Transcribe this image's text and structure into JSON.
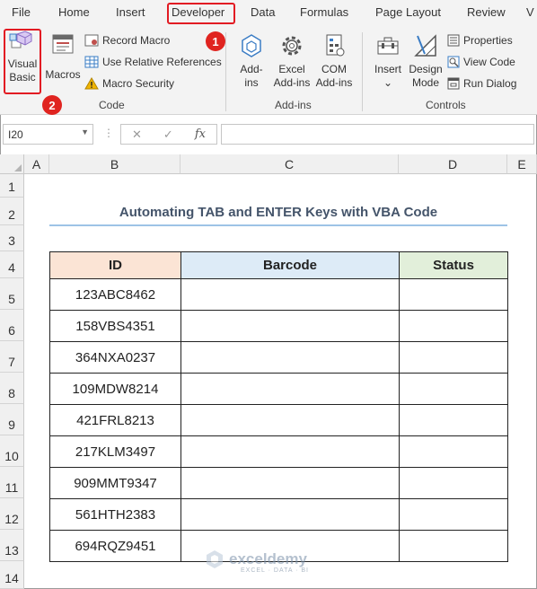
{
  "ribbon": {
    "tabs": [
      "File",
      "Home",
      "Insert",
      "Developer",
      "Data",
      "Formulas",
      "Page Layout",
      "Review",
      "V"
    ],
    "active_tab": "Developer",
    "code_group": {
      "label": "Code",
      "visual_basic": [
        "Visual",
        "Basic"
      ],
      "macros": "Macros",
      "record_macro": "Record Macro",
      "relative_refs": "Use Relative References",
      "macro_security": "Macro Security"
    },
    "addins_group": {
      "label": "Add-ins",
      "addins": [
        "Add-",
        "ins"
      ],
      "excel_addins": [
        "Excel",
        "Add-ins"
      ],
      "com_addins": [
        "COM",
        "Add-ins"
      ]
    },
    "controls_group": {
      "label": "Controls",
      "insert": "Insert",
      "design_mode": [
        "Design",
        "Mode"
      ],
      "properties": "Properties",
      "view_code": "View Code",
      "run_dialog": "Run Dialog"
    },
    "badges": [
      "1",
      "2"
    ],
    "accent_color": "#e21b23"
  },
  "formula_bar": {
    "name_box": "I20",
    "cancel_symbol": "✕",
    "enter_symbol": "✓",
    "fx_symbol": "fx",
    "formula": ""
  },
  "sheet": {
    "columns": [
      "A",
      "B",
      "C",
      "D",
      "E"
    ],
    "rows": [
      "1",
      "2",
      "3",
      "4",
      "5",
      "6",
      "7",
      "8",
      "9",
      "10",
      "11",
      "12",
      "13",
      "14"
    ],
    "title": "Automating TAB and ENTER Keys with VBA Code",
    "table": {
      "headers": [
        "ID",
        "Barcode",
        "Status"
      ],
      "rows": [
        [
          "123ABC8462",
          "",
          ""
        ],
        [
          "158VBS4351",
          "",
          ""
        ],
        [
          "364NXA0237",
          "",
          ""
        ],
        [
          "109MDW8214",
          "",
          ""
        ],
        [
          "421FRL8213",
          "",
          ""
        ],
        [
          "217KLM3497",
          "",
          ""
        ],
        [
          "909MMT9347",
          "",
          ""
        ],
        [
          "561HTH2383",
          "",
          ""
        ],
        [
          "694RQZ9451",
          "",
          ""
        ]
      ]
    },
    "header_colors": [
      "#fbe4d5",
      "#ddebf7",
      "#e2efda"
    ]
  },
  "watermark": {
    "name": "exceldemy",
    "tagline": "EXCEL · DATA · BI"
  }
}
